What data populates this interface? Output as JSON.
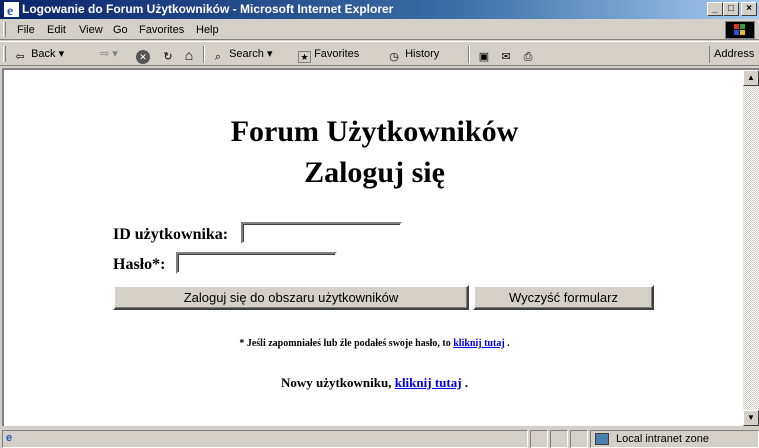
{
  "window": {
    "title": "Logowanie do Forum Użytkowników - Microsoft Internet Explorer",
    "buttons": {
      "minimize": "_",
      "maximize": "□",
      "close": "×"
    }
  },
  "menu": [
    "File",
    "Edit",
    "View",
    "Go",
    "Favorites",
    "Help"
  ],
  "toolbar": {
    "back": "Back",
    "forward": "⇨",
    "stop": "✕",
    "refresh": "↻",
    "home": "⌂",
    "search": "Search",
    "favorites": "Favorites",
    "history": "History",
    "address_label": "Address"
  },
  "page": {
    "title_line1": "Forum Użytkowników",
    "title_line2": "Zaloguj się",
    "user_id_label": "ID użytkownika:",
    "user_id_value": "",
    "password_label": "Hasło*:",
    "password_value": "",
    "login_button": "Zaloguj się do obszaru użytkowników",
    "clear_button": "Wyczyść formularz",
    "note_text": "* Jeśli zapomniałeś lub źle podałeś swoje hasło, to",
    "note_link": "kliknij tutaj",
    "note_end": ".",
    "new_user_text": "Nowy użytkowniku,",
    "new_user_link": "kliknij tutaj",
    "new_user_end": "."
  },
  "statusbar": {
    "zone": "Local intranet zone"
  }
}
